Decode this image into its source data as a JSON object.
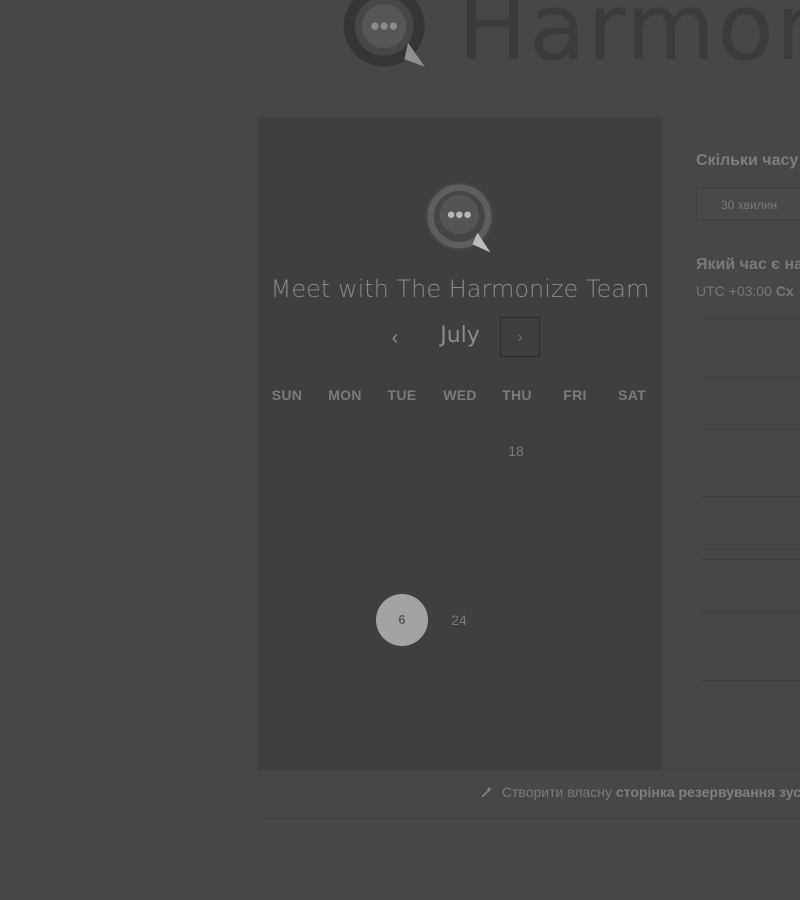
{
  "brand": {
    "name": "Harmonize",
    "logo_icon": "chat-bubble-logo-icon"
  },
  "calendar": {
    "meeting_title": "Meet with The Harmonize Team",
    "month": "July",
    "prev_symbol": "‹",
    "next_symbol": "›",
    "weekdays": [
      "SUN",
      "MON",
      "TUE",
      "WED",
      "THU",
      "FRI",
      "SAT"
    ],
    "days": {
      "day_18": "18",
      "day_6": "6",
      "day_24": "24"
    }
  },
  "right_panel": {
    "duration_title": "Скільки часу",
    "duration_value": "30 хвилин",
    "time_question": "Який час є на",
    "timezone_prefix": "UTC +03:00",
    "timezone_name": "Сх"
  },
  "footer": {
    "text_prefix": "Створити власну",
    "text_strong": "сторінка резервування зус",
    "icon": "magic-wand-icon"
  },
  "colors": {
    "overlay_background": "#474747",
    "card_background": "#3f3f3f",
    "selected_day": "#a3a3a3"
  }
}
